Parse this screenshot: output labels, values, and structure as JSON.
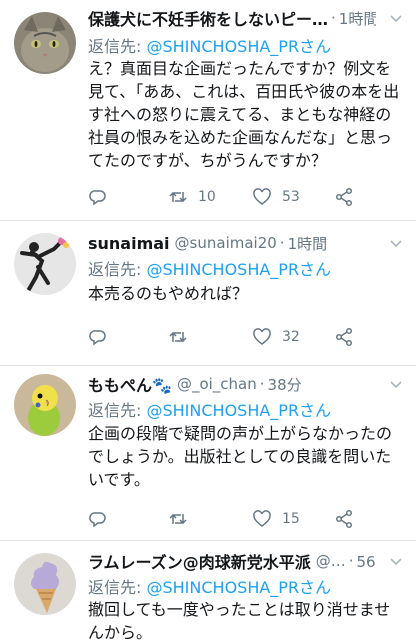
{
  "reply_prefix": "返信先: ",
  "tweets": [
    {
      "name": "保護犬に不妊手術をしないピー…",
      "handle": "",
      "time": "1時間",
      "reply_to": "@SHINCHOSHA_PRさん",
      "text": "え？真面目な企画だったんですか？例文を見て、「ああ、これは、百田氏や彼の本を出す社への怒りに震えてる、まともな神経の社員の恨みを込めた企画なんだな」と思ってたのですが、ちがうんですか？",
      "replies": "",
      "retweets": "10",
      "likes": "53",
      "avatar_icon": "cat-avatar"
    },
    {
      "name": "sunaimai",
      "handle": "@sunaimai20",
      "time": "1時間",
      "reply_to": "@SHINCHOSHA_PRさん",
      "text": "本売るのもやめれば？",
      "replies": "",
      "retweets": "",
      "likes": "32",
      "avatar_icon": "flower-thrower-avatar"
    },
    {
      "name": "ももぺん🐾",
      "handle": "@_oi_chan",
      "time": "38分",
      "reply_to": "@SHINCHOSHA_PRさん",
      "text": "企画の段階で疑問の声が上がらなかったのでしょうか。出版社としての良識を問いたいです。",
      "replies": "",
      "retweets": "",
      "likes": "15",
      "avatar_icon": "parakeet-avatar"
    },
    {
      "name": "ラムレーズン@肉球新党水平派",
      "handle": "@…",
      "time": "56分",
      "reply_to": "@SHINCHOSHA_PRさん",
      "text": "撤回しても一度やったことは取り消せませんから。",
      "replies": "",
      "retweets": "",
      "likes": "",
      "avatar_icon": "soft-serve-avatar"
    }
  ]
}
